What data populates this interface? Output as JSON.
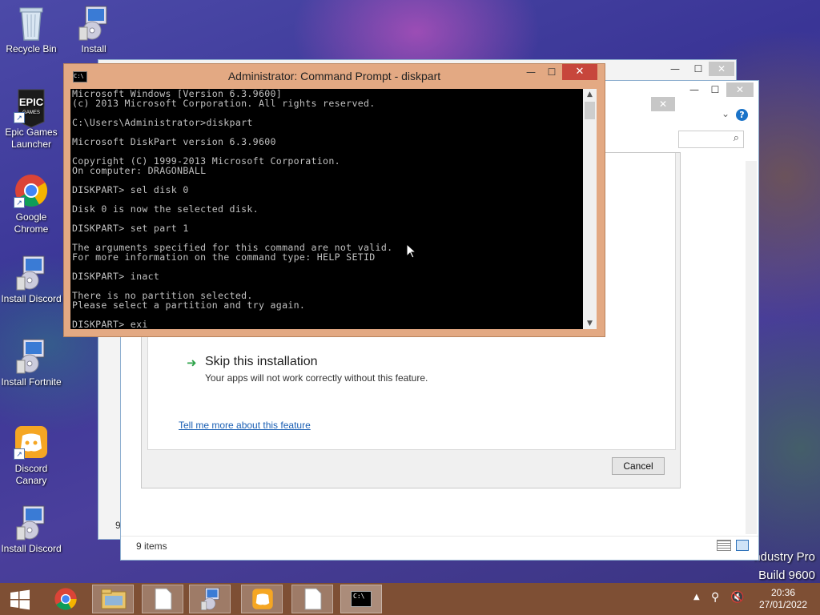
{
  "desktop_icons": [
    {
      "name": "recycle-bin",
      "label": "Recycle Bin"
    },
    {
      "name": "install",
      "label": "Install"
    },
    {
      "name": "epic-games-launcher",
      "label": "Epic Games Launcher"
    },
    {
      "name": "google-chrome",
      "label": "Google Chrome"
    },
    {
      "name": "install-discord-1",
      "label": "Install Discord"
    },
    {
      "name": "install-fortnite",
      "label": "Install Fortnite"
    },
    {
      "name": "discord-canary",
      "label": "Discord Canary"
    },
    {
      "name": "install-discord-2",
      "label": "Install Discord"
    }
  ],
  "cmd": {
    "title": "Administrator: Command Prompt - diskpart",
    "icon_text": "C:\\",
    "lines": [
      "Microsoft Windows [Version 6.3.9600]",
      "(c) 2013 Microsoft Corporation. All rights reserved.",
      "",
      "C:\\Users\\Administrator>diskpart",
      "",
      "Microsoft DiskPart version 6.3.9600",
      "",
      "Copyright (C) 1999-2013 Microsoft Corporation.",
      "On computer: DRAGONBALL",
      "",
      "DISKPART> sel disk 0",
      "",
      "Disk 0 is now the selected disk.",
      "",
      "DISKPART> set part 1",
      "",
      "The arguments specified for this command are not valid.",
      "For more information on the command type: HELP SETID",
      "",
      "DISKPART> inact",
      "",
      "There is no partition selected.",
      "Please select a partition and try again.",
      "",
      "DISKPART> exi_"
    ]
  },
  "dialog": {
    "skip_title": "Skip this installation",
    "skip_desc": "Your apps will not work correctly without this feature.",
    "tell_me_link": "Tell me more about this feature",
    "cancel_label": "Cancel"
  },
  "explorer": {
    "items_count": "9 items",
    "partial_char": "9"
  },
  "watermark": {
    "line1": "ndustry Pro",
    "line2": "Build 9600"
  },
  "taskbar": {
    "time": "20:36",
    "date": "27/01/2022",
    "cmd_icon_text": "C:\\"
  },
  "colors": {
    "cmd_frame": "#e3a983",
    "taskbar": "#7e4f34",
    "close_button": "#c7463c",
    "link": "#1a5fb4"
  }
}
